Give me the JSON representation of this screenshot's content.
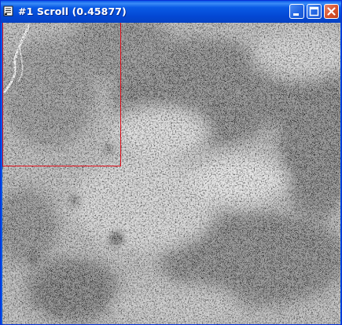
{
  "window": {
    "title": "#1 Scroll (0.45877)"
  },
  "titlebar": {
    "icons": {
      "system_menu": "document-icon",
      "minimize": "minimize-icon",
      "maximize": "maximize-icon",
      "close": "close-icon"
    }
  },
  "image_view": {
    "content": "grayscale-satellite-image",
    "roi_color": "#e0101c"
  }
}
